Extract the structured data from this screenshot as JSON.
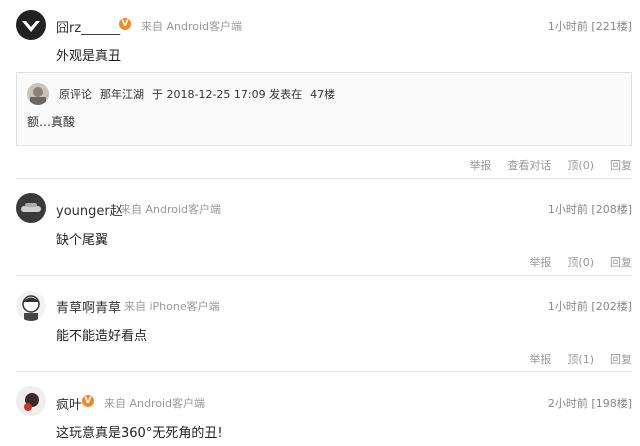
{
  "comments": [
    {
      "name": "囧rz______",
      "vip": "V",
      "source": "来自 Android客户端",
      "meta": "1小时前 [221楼]",
      "content": "外观是真丑",
      "quote": {
        "label": "原评论",
        "author": "那年江湖",
        "date": "于 2018-12-25 17:09 发表在",
        "floor": "47楼",
        "text": "额…真酸"
      },
      "actions": [
        "举报",
        "查看对话",
        "顶(0)",
        "回复"
      ]
    },
    {
      "name": "younger赵",
      "source": "来自 Android客户端",
      "meta": "1小时前 [208楼]",
      "content": "缺个尾翼",
      "actions": [
        "举报",
        "顶(0)",
        "回复"
      ]
    },
    {
      "name": "青草啊青草",
      "source": "来自 iPhone客户端",
      "meta": "1小时前 [202楼]",
      "content": "能不能造好看点",
      "actions": [
        "举报",
        "顶(1)",
        "回复"
      ]
    },
    {
      "name": "疯叶",
      "vip": "V",
      "source": "来自 Android客户端",
      "meta": "2小时前 [198楼]",
      "content": "这玩意真是360°无死角的丑!"
    }
  ]
}
